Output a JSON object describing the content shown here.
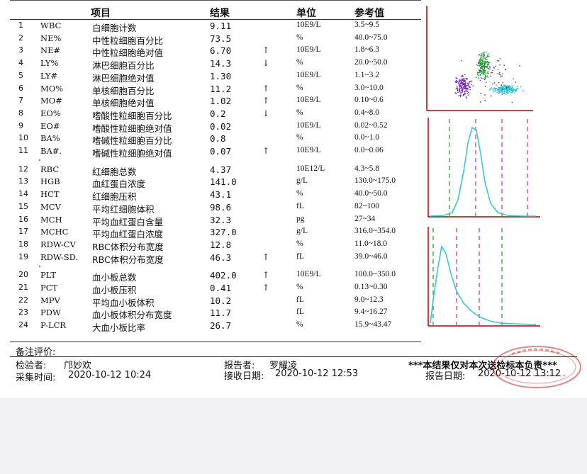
{
  "header": {
    "item": "项目",
    "result": "结果",
    "unit": "单位",
    "reference": "参考值"
  },
  "rows": [
    {
      "no": "1",
      "code": "WBC",
      "name": "白细胞计数",
      "result": "9.11",
      "flag": "",
      "unit": "10E9/L",
      "ref": "3.5~9.5"
    },
    {
      "no": "2",
      "code": "NE%",
      "name": "中性粒细胞百分比",
      "result": "73.5",
      "flag": "",
      "unit": "%",
      "ref": "40.0~75.0"
    },
    {
      "no": "3",
      "code": "NE#",
      "name": "中性粒细胞绝对值",
      "result": "6.70",
      "flag": "↑",
      "unit": "10E9/L",
      "ref": "1.8~6.3"
    },
    {
      "no": "4",
      "code": "LY%",
      "name": "淋巴细胞百分比",
      "result": "14.3",
      "flag": "↓",
      "unit": "%",
      "ref": "20.0~50.0"
    },
    {
      "no": "5",
      "code": "LY#",
      "name": "淋巴细胞绝对值",
      "result": "1.30",
      "flag": "",
      "unit": "10E9/L",
      "ref": "1.1~3.2"
    },
    {
      "no": "6",
      "code": "MO%",
      "name": "单核细胞百分比",
      "result": "11.2",
      "flag": "↑",
      "unit": "%",
      "ref": "3.0~10.0"
    },
    {
      "no": "7",
      "code": "MO#",
      "name": "单核细胞绝对值",
      "result": "1.02",
      "flag": "↑",
      "unit": "10E9/L",
      "ref": "0.10~0.6"
    },
    {
      "no": "8",
      "code": "EO%",
      "name": "嗜酸性粒细胞百分比",
      "result": "0.2",
      "flag": "↓",
      "unit": "%",
      "ref": "0.4~8.0"
    },
    {
      "no": "9",
      "code": "EO#",
      "name": "嗜酸性粒细胞绝对值",
      "result": "0.02",
      "flag": "",
      "unit": "10E9/L",
      "ref": "0.02~0.52"
    },
    {
      "no": "10",
      "code": "BA%",
      "name": "嗜碱性粒细胞百分比",
      "result": "0.8",
      "flag": "",
      "unit": "%",
      "ref": "0.0~1.0"
    },
    {
      "no": "11",
      "code": "BA#.",
      "name": "嗜碱性粒细胞绝对值",
      "result": "0.07",
      "flag": "↑",
      "unit": "10E9/L",
      "ref": "0.0~0.06"
    },
    {
      "no": "12",
      "code": "RBC",
      "name": "红细胞总数",
      "result": "4.37",
      "flag": "",
      "unit": "10E12/L",
      "ref": "4.3~5.8"
    },
    {
      "no": "13",
      "code": "HGB",
      "name": "血红蛋白浓度",
      "result": "141.0",
      "flag": "",
      "unit": "g/L",
      "ref": "130.0~175.0"
    },
    {
      "no": "14",
      "code": "HCT",
      "name": "红细胞压积",
      "result": "43.1",
      "flag": "",
      "unit": "%",
      "ref": "40.0~50.0"
    },
    {
      "no": "15",
      "code": "MCV",
      "name": "平均红细胞体积",
      "result": "98.6",
      "flag": "",
      "unit": "fL",
      "ref": "82~100"
    },
    {
      "no": "16",
      "code": "MCH",
      "name": "平均血红蛋白含量",
      "result": "32.3",
      "flag": "",
      "unit": "pg",
      "ref": "27~34"
    },
    {
      "no": "17",
      "code": "MCHC",
      "name": "平均血红蛋白浓度",
      "result": "327.0",
      "flag": "",
      "unit": "g/L",
      "ref": "316.0~354.0"
    },
    {
      "no": "18",
      "code": "RDW-CV",
      "name": "RBC体积分布宽度",
      "result": "12.8",
      "flag": "",
      "unit": "%",
      "ref": "11.0~18.0"
    },
    {
      "no": "19",
      "code": "RDW-SD.",
      "name": "RBC体积分布宽度",
      "result": "46.3",
      "flag": "↑",
      "unit": "fL",
      "ref": "39.0~46.0"
    },
    {
      "no": "20",
      "code": "PLT",
      "name": "血小板总数",
      "result": "402.0",
      "flag": "↑",
      "unit": "10E9/L",
      "ref": "100.0~350.0"
    },
    {
      "no": "21",
      "code": "PCT",
      "name": "血小板压积",
      "result": "0.41",
      "flag": "↑",
      "unit": "%",
      "ref": "0.13~0.30"
    },
    {
      "no": "22",
      "code": "MPV",
      "name": "平均血小板体积",
      "result": "10.2",
      "flag": "",
      "unit": "fL",
      "ref": "9.0~12.3"
    },
    {
      "no": "23",
      "code": "PDW",
      "name": "血小板体积分布宽度",
      "result": "11.7",
      "flag": "",
      "unit": "fL",
      "ref": "9.4~16.27"
    },
    {
      "no": "24",
      "code": "P-LCR",
      "name": "大血小板比率",
      "result": "26.7",
      "flag": "",
      "unit": "%",
      "ref": "15.9~43.47"
    }
  ],
  "footer": {
    "remark_label": "备注评价:",
    "inspector_label": "检验者:",
    "inspector": "邝妙欢",
    "reporter_label": "报告者:",
    "reporter": "罗耀凌",
    "disclaimer": "***本结果仅对本次送检标本负责***",
    "collect_label": "采集时间:",
    "collect_time": "2020-10-12 10:24",
    "receive_label": "接收日期:",
    "receive_time": "2020-10-12 12:53",
    "report_label": "报告日期:",
    "report_time": "2020-10-12 13:12"
  },
  "colors": {
    "curve": "#3cc6d6",
    "marker_green": "#2e9e3a",
    "marker_pink": "#c63ab5",
    "frame": "#b30000",
    "stamp": "#cc2222"
  }
}
